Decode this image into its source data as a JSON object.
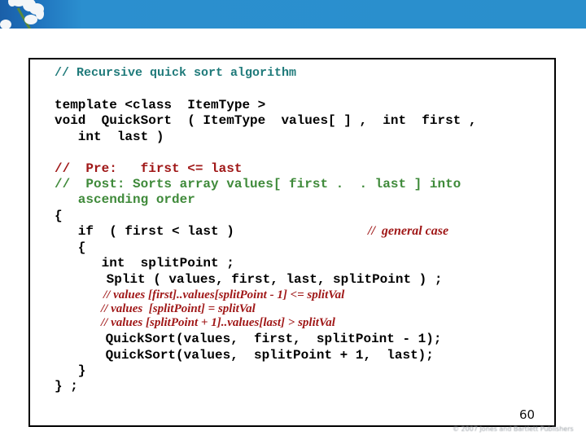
{
  "header": {
    "banner_color": "#2a8fcc",
    "decoration": "white-orchid-flowers"
  },
  "code": {
    "title_comment": "// Recursive quick sort algorithm",
    "lines": [
      {
        "text": "template <class  ItemType >",
        "style": "black"
      },
      {
        "text": "void  QuickSort  ( ItemType  values[ ] ,  int  first ,",
        "style": "black"
      },
      {
        "text": "   int  last )",
        "style": "black"
      },
      {
        "text": "//  Pre:   first <= last",
        "style": "red"
      },
      {
        "text": "//  Post: Sorts array values[ first .  . last ] into",
        "style": "green"
      },
      {
        "text": "   ascending order",
        "style": "green"
      },
      {
        "text": "{",
        "style": "black"
      },
      {
        "text": "   if  ( first < last )",
        "style": "black",
        "trailing_comment": "//  general case"
      },
      {
        "text": "   {",
        "style": "black"
      },
      {
        "text": "      int  splitPoint ;",
        "style": "black"
      },
      {
        "text": "      Split ( values, first, last, splitPoint ) ;",
        "style": "black"
      },
      {
        "text": "// values [first]..values[splitPoint - 1] <= splitVal",
        "style": "red-italic"
      },
      {
        "text": "// values  [splitPoint] = splitVal",
        "style": "red-italic"
      },
      {
        "text": "// values [splitPoint + 1]..values[last] > splitVal",
        "style": "red-italic"
      },
      {
        "text": "      QuickSort(values,  first,  splitPoint - 1);",
        "style": "black"
      },
      {
        "text": "      QuickSort(values,  splitPoint + 1,  last);",
        "style": "black"
      },
      {
        "text": "   }",
        "style": "black"
      },
      {
        "text": "} ;",
        "style": "black"
      }
    ],
    "colors": {
      "title": "#1f7a7a",
      "pre": "#a01818",
      "post": "#3f8a3a",
      "code": "#000000"
    }
  },
  "page_number": "60",
  "footer": "© 2007 Jones and Bartlett Publishers"
}
